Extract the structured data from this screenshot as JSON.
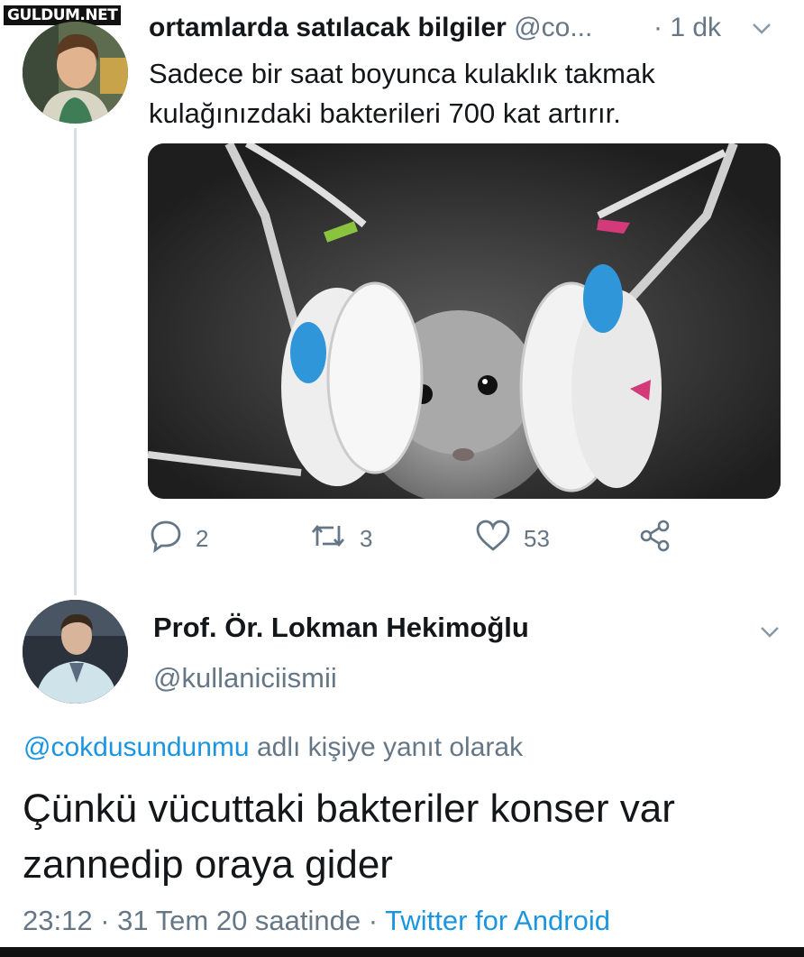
{
  "watermark": "GULDUM.NET",
  "tweet1": {
    "display_name": "ortamlarda satılacak bilgiler",
    "handle": "@co...",
    "time": "· 1 dk",
    "text_line1": "Sadece bir saat boyunca kulaklık takmak",
    "text_line2": "kulağınızdaki bakterileri 700 kat artırır.",
    "media_alt": "hamster wearing headphones",
    "stats": {
      "replies": "2",
      "retweets": "3",
      "likes": "53"
    }
  },
  "tweet2": {
    "display_name": "Prof. Ör. Lokman Hekimoğlu",
    "handle": "@kullaniciismii",
    "reply_mention": "@cokdusundunmu",
    "reply_suffix": " adlı kişiye yanıt olarak",
    "text_line1": "Çünkü vücuttaki bakteriler konser var",
    "text_line2": "zannedip oraya gider",
    "time": "23:12 · 31 Tem 20 saatinde · ",
    "source": "Twitter for Android"
  },
  "icons": {
    "reply": "reply-icon",
    "retweet": "retweet-icon",
    "like": "heart-icon",
    "share": "share-icon",
    "menu": "chevron-down-icon"
  },
  "colors": {
    "link": "#1b95e0",
    "muted": "#657786",
    "text": "#14171a"
  }
}
